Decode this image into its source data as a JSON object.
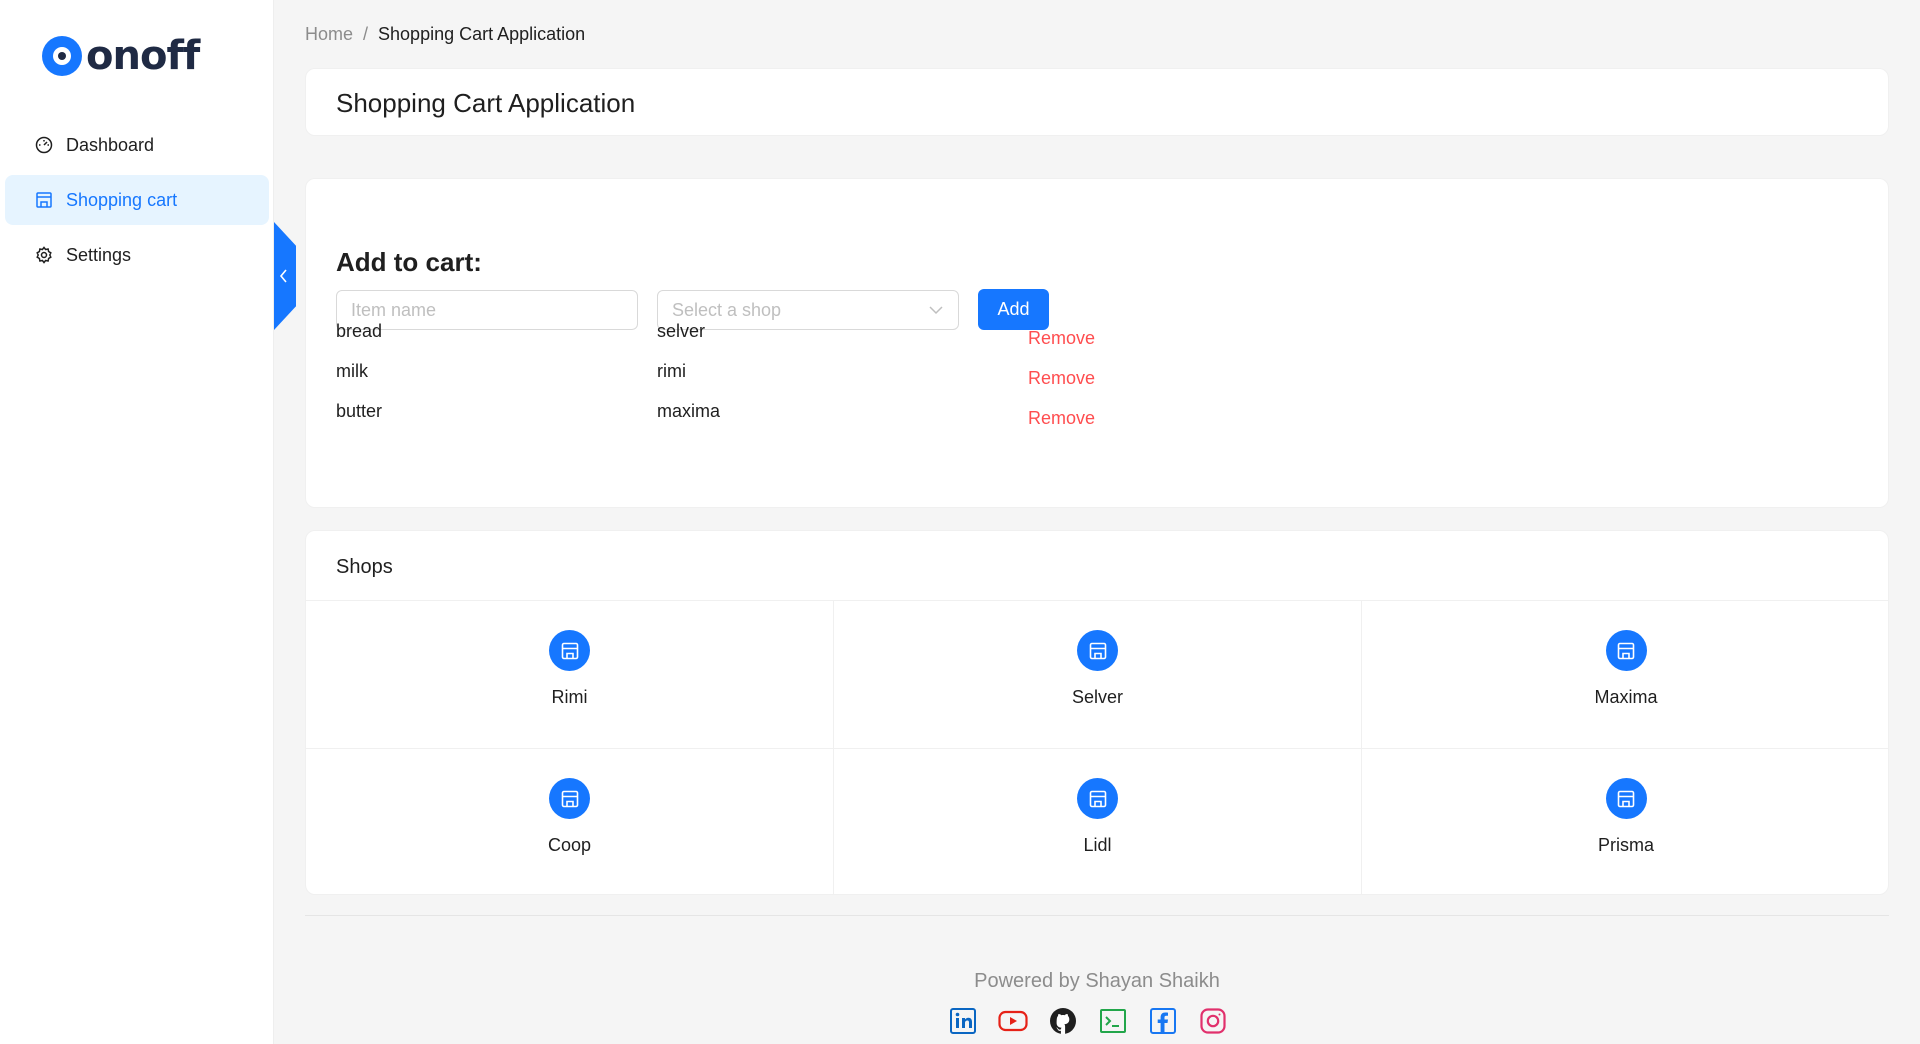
{
  "brand": {
    "name": "onoff",
    "accent": "#1677ff"
  },
  "sidebar": {
    "items": [
      {
        "label": "Dashboard",
        "icon": "dashboard-icon"
      },
      {
        "label": "Shopping cart",
        "icon": "shop-icon"
      },
      {
        "label": "Settings",
        "icon": "gear-icon"
      }
    ],
    "active": "Shopping cart"
  },
  "breadcrumb": {
    "home": "Home",
    "separator": "/",
    "current": "Shopping Cart Application"
  },
  "header": {
    "title": "Shopping Cart Application"
  },
  "cart": {
    "heading": "Add to cart:",
    "item_placeholder": "Item name",
    "shop_placeholder": "Select a shop",
    "add_label": "Add",
    "remove_label": "Remove",
    "remove_color": "#ff4d4f",
    "rows": [
      {
        "item": "bread",
        "shop": "selver"
      },
      {
        "item": "milk",
        "shop": "rimi"
      },
      {
        "item": "butter",
        "shop": "maxima"
      }
    ]
  },
  "shops": {
    "title": "Shops",
    "items": [
      "Rimi",
      "Selver",
      "Maxima",
      "Coop",
      "Lidl",
      "Prisma"
    ]
  },
  "footer": {
    "text": "Powered by Shayan Shaikh",
    "socials": [
      "linkedin-icon",
      "youtube-icon",
      "github-icon",
      "terminal-icon",
      "facebook-icon",
      "instagram-icon"
    ]
  }
}
